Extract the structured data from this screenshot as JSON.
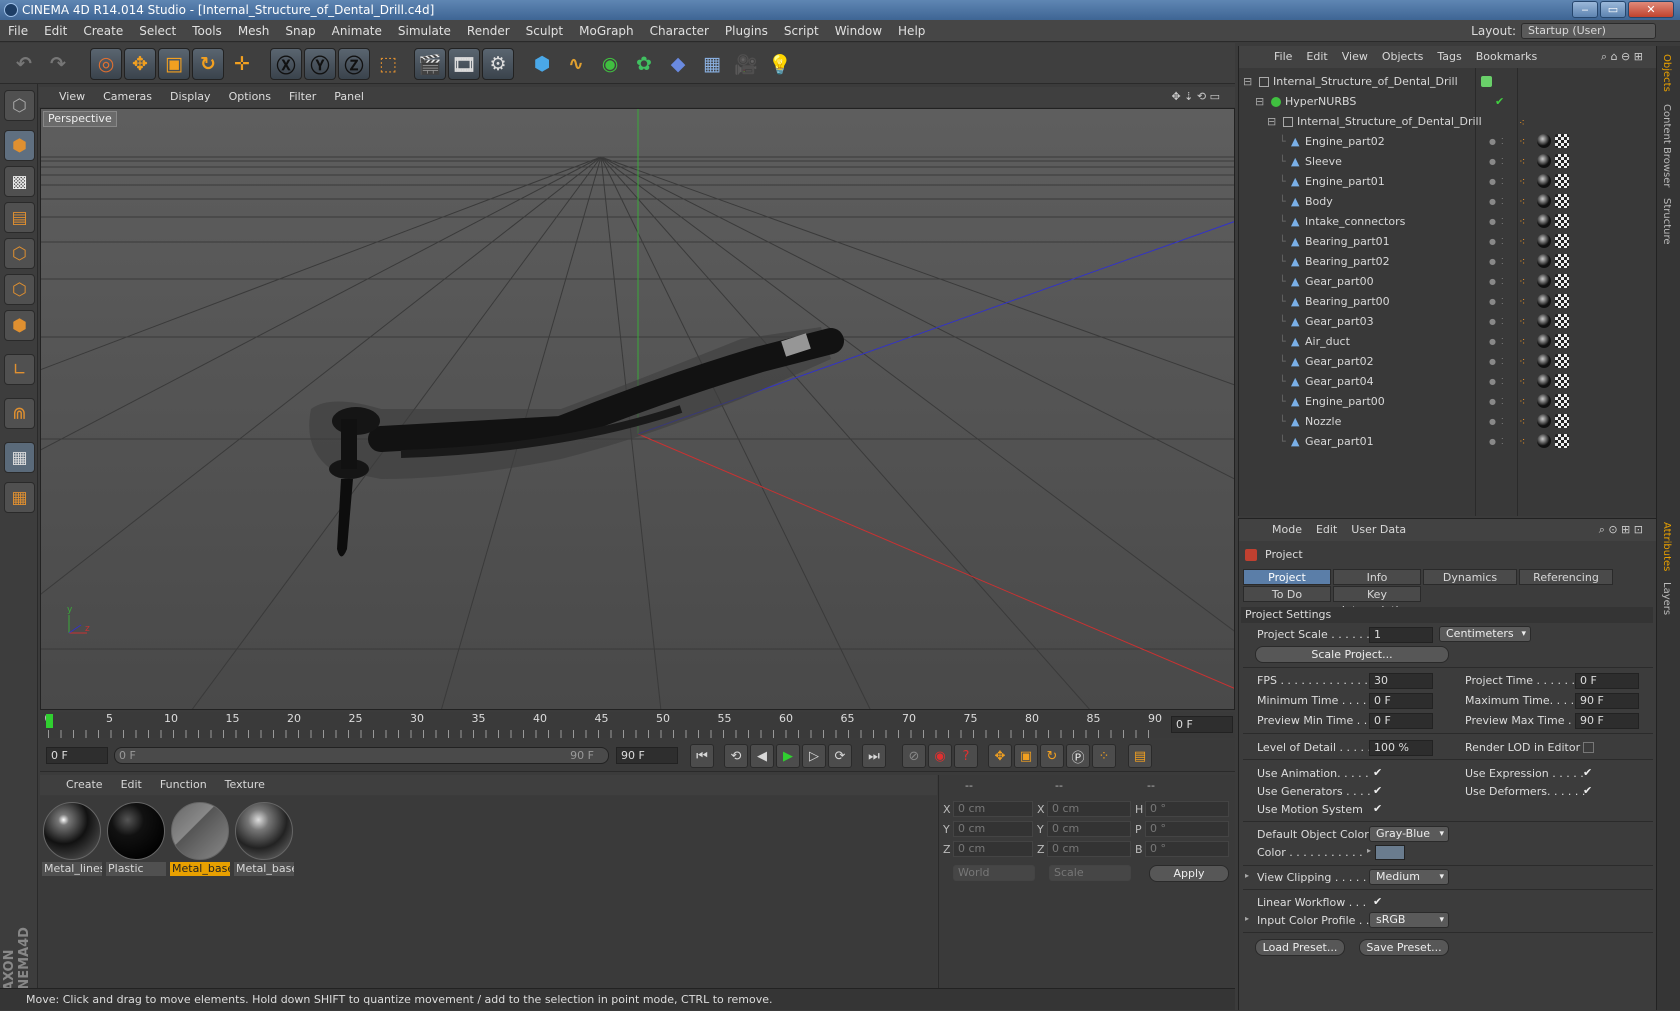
{
  "window": {
    "title": "CINEMA 4D R14.014 Studio - [Internal_Structure_of_Dental_Drill.c4d]",
    "min": "‒",
    "max": "▭",
    "close": "✕"
  },
  "menu": [
    "File",
    "Edit",
    "Create",
    "Select",
    "Tools",
    "Mesh",
    "Snap",
    "Animate",
    "Simulate",
    "Render",
    "Sculpt",
    "MoGraph",
    "Character",
    "Plugins",
    "Script",
    "Window",
    "Help"
  ],
  "layout": {
    "label": "Layout:",
    "value": "Startup (User)"
  },
  "viewport": {
    "menu": [
      "View",
      "Cameras",
      "Display",
      "Options",
      "Filter",
      "Panel"
    ],
    "label": "Perspective",
    "axis_y": "y",
    "axis_z": "z"
  },
  "timeline": {
    "ticks": [
      "0",
      "5",
      "10",
      "15",
      "20",
      "25",
      "30",
      "35",
      "40",
      "45",
      "50",
      "55",
      "60",
      "65",
      "70",
      "75",
      "80",
      "85",
      "90"
    ],
    "end_field": "0 F"
  },
  "playbar": {
    "start": "0 F",
    "range_start": "0 F",
    "range_end": "90 F",
    "end": "90 F"
  },
  "materials": {
    "menu": [
      "Create",
      "Edit",
      "Function",
      "Texture"
    ],
    "items": [
      {
        "name": "Metal_lines",
        "selected": false
      },
      {
        "name": "Plastic",
        "selected": false
      },
      {
        "name": "Metal_base",
        "selected": true
      },
      {
        "name": "Metal_base",
        "selected": false
      }
    ]
  },
  "coords": {
    "header": [
      "--",
      "--",
      "--"
    ],
    "rows": [
      {
        "a": "X",
        "av": "0 cm",
        "b": "X",
        "bv": "0 cm",
        "c": "H",
        "cv": "0 °"
      },
      {
        "a": "Y",
        "av": "0 cm",
        "b": "Y",
        "bv": "0 cm",
        "c": "P",
        "cv": "0 °"
      },
      {
        "a": "Z",
        "av": "0 cm",
        "b": "Z",
        "bv": "0 cm",
        "c": "B",
        "cv": "0 °"
      }
    ],
    "world": "World",
    "scale": "Scale",
    "apply": "Apply"
  },
  "status": "Move: Click and drag to move elements. Hold down SHIFT to quantize movement / add to the selection in point mode, CTRL to remove.",
  "objects": {
    "menu": [
      "File",
      "Edit",
      "View",
      "Objects",
      "Tags",
      "Bookmarks"
    ],
    "root": "Internal_Structure_of_Dental_Drill",
    "nurbs": "HyperNURBS",
    "group": "Internal_Structure_of_Dental_Drill",
    "children": [
      "Engine_part02",
      "Sleeve",
      "Engine_part01",
      "Body",
      "Intake_connectors",
      "Bearing_part01",
      "Bearing_part02",
      "Gear_part00",
      "Bearing_part00",
      "Gear_part03",
      "Air_duct",
      "Gear_part02",
      "Gear_part04",
      "Engine_part00",
      "Nozzle",
      "Gear_part01"
    ]
  },
  "side_tabs": [
    "Objects",
    "Content Browser",
    "Structure",
    "Attributes",
    "Layers"
  ],
  "attributes": {
    "menu": [
      "Mode",
      "Edit",
      "User Data"
    ],
    "object": "Project",
    "tabs": [
      "Project Settings",
      "Info",
      "Dynamics",
      "Referencing",
      "To Do",
      "Key Interpolation"
    ],
    "section": "Project Settings",
    "project_scale": {
      "label": "Project Scale . . . . . .",
      "value": "1",
      "unit": "Centimeters"
    },
    "scale_project": "Scale Project...",
    "fps": {
      "label": "FPS . . . . . . . . . . . . . .",
      "value": "30"
    },
    "project_time": {
      "label": "Project Time . . . . . . .",
      "value": "0 F"
    },
    "min_time": {
      "label": "Minimum Time . . . . .",
      "value": "0 F"
    },
    "max_time": {
      "label": "Maximum Time. . . . .",
      "value": "90 F"
    },
    "prev_min": {
      "label": "Preview Min Time . . .",
      "value": "0 F"
    },
    "prev_max": {
      "label": "Preview Max Time . . .",
      "value": "90 F"
    },
    "lod": {
      "label": "Level of Detail . . . . .",
      "value": "100 %"
    },
    "render_lod": "Render LOD in Editor",
    "use_animation": "Use Animation. . . . .",
    "use_expression": "Use Expression . . . . .",
    "use_generators": "Use Generators . . . .",
    "use_deformers": "Use Deformers. . . . . .",
    "use_motion": "Use Motion System",
    "default_color": {
      "label": "Default Object Color",
      "value": "Gray-Blue"
    },
    "color": {
      "label": "Color . . . . . . . . . . .",
      "swatch": "#6a7c8e"
    },
    "view_clipping": {
      "label": "View Clipping . . . . .",
      "value": "Medium"
    },
    "linear_workflow": "Linear Workflow . . .",
    "input_profile": {
      "label": "Input Color Profile . .",
      "value": "sRGB"
    },
    "load_preset": "Load Preset...",
    "save_preset": "Save Preset..."
  },
  "colors": {
    "accent": "#e8a000",
    "tab_active": "#5b7ea8",
    "axis_x": "#c03030",
    "axis_y": "#30a030",
    "axis_z": "#3030c0"
  }
}
